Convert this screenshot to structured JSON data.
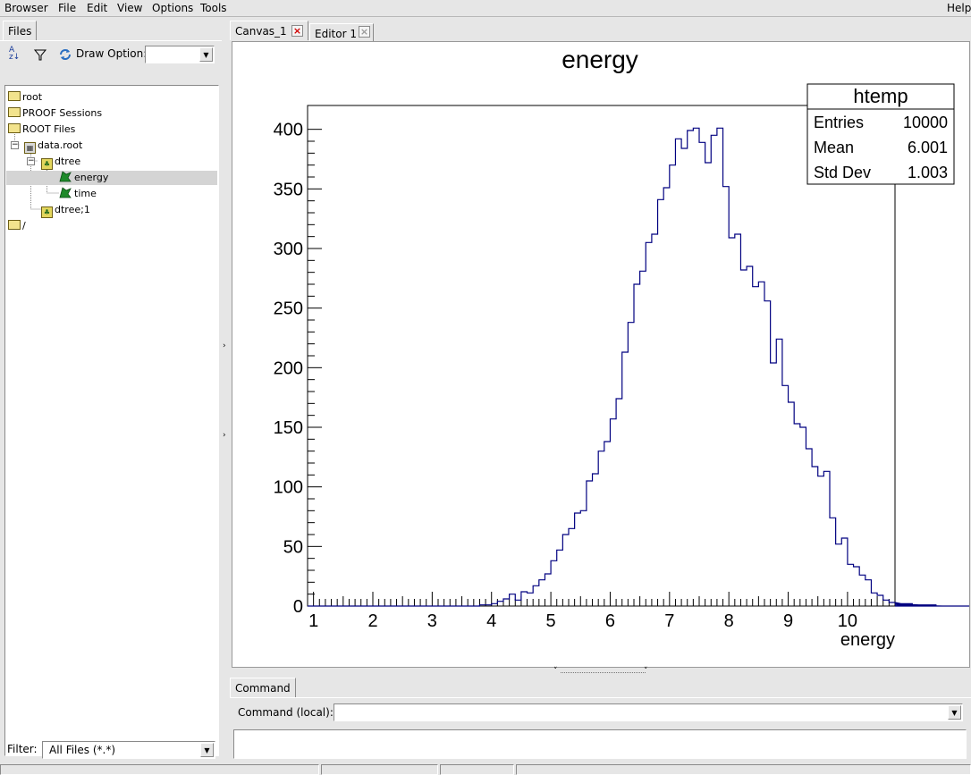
{
  "menu": {
    "items": [
      {
        "label": "Browser"
      },
      {
        "label": "File"
      },
      {
        "label": "Edit"
      },
      {
        "label": "View"
      },
      {
        "label": "Options"
      },
      {
        "label": "Tools"
      }
    ],
    "help": "Help"
  },
  "left_panel": {
    "tab": "Files",
    "draw_option_label": "Draw Option:",
    "draw_option_value": "",
    "filter_label": "Filter:",
    "filter_value": "All Files (*.*)",
    "tree": {
      "root": "root",
      "proof": "PROOF Sessions",
      "root_files": "ROOT Files",
      "file": "data.root",
      "tree_name": "dtree",
      "branch1": "energy",
      "branch2": "time",
      "key": "dtree;1",
      "slash": "/"
    }
  },
  "tabs": [
    {
      "label": "Canvas_1",
      "active": true
    },
    {
      "label": "Editor 1",
      "active": false
    }
  ],
  "command": {
    "tab": "Command",
    "label": "Command (local):",
    "value": ""
  },
  "stats": {
    "title": "htemp",
    "rows": [
      {
        "name": "Entries",
        "value": "10000"
      },
      {
        "name": "Mean",
        "value": "6.001"
      },
      {
        "name": "Std Dev",
        "value": "1.003"
      }
    ]
  },
  "chart_data": {
    "type": "bar",
    "style": "step-histogram",
    "title": "energy",
    "xlabel": "energy",
    "ylabel": "",
    "xlim": [
      0.9,
      10.8
    ],
    "ylim": [
      0,
      420
    ],
    "x_ticks": [
      1,
      2,
      3,
      4,
      5,
      6,
      7,
      8,
      9,
      10
    ],
    "y_ticks": [
      0,
      50,
      100,
      150,
      200,
      250,
      300,
      350,
      400
    ],
    "bin_width": 0.1,
    "x_start": 0.9,
    "line_color": "#000080",
    "values": [
      0,
      0,
      0,
      0,
      0,
      0,
      0,
      0,
      0,
      0,
      0,
      0,
      0,
      0,
      0,
      0,
      0,
      0,
      0,
      0,
      0,
      0,
      0,
      0,
      0,
      0,
      0,
      0,
      0,
      1,
      1,
      2,
      4,
      6,
      10,
      5,
      12,
      11,
      17,
      22,
      27,
      38,
      47,
      60,
      65,
      78,
      80,
      105,
      111,
      130,
      138,
      157,
      174,
      213,
      238,
      270,
      281,
      305,
      312,
      341,
      351,
      370,
      392,
      384,
      399,
      401,
      389,
      372,
      395,
      401,
      352,
      309,
      312,
      282,
      285,
      268,
      272,
      256,
      204,
      224,
      185,
      171,
      153,
      150,
      132,
      117,
      109,
      113,
      74,
      52,
      57,
      35,
      33,
      26,
      22,
      11,
      9,
      5,
      3,
      3,
      2,
      1,
      2,
      1,
      1,
      0,
      1,
      0,
      0,
      0,
      0,
      0,
      0,
      0,
      0,
      0,
      0,
      0,
      0,
      0
    ]
  }
}
